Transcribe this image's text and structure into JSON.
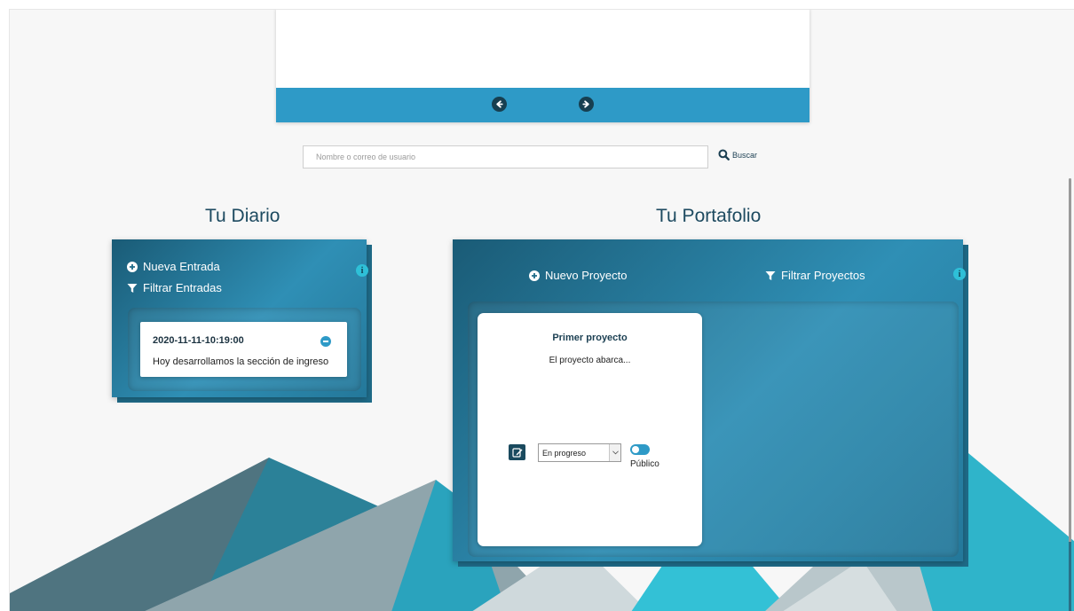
{
  "colors": {
    "accent": "#2e9ac7",
    "panel": "#1f6b88",
    "heading": "#1d4a60",
    "background": "#f7f7f7"
  },
  "carousel": {
    "prev_icon": "arrow-circle-left-icon",
    "next_icon": "arrow-circle-right-icon"
  },
  "search": {
    "placeholder": "Nombre o correo de usuario",
    "button_label": "Buscar",
    "icon": "search-icon"
  },
  "diario": {
    "title": "Tu Diario",
    "new_entry_label": "Nueva Entrada",
    "filter_label": "Filtrar Entradas",
    "entries": [
      {
        "date": "2020-11-11-10:19:00",
        "text": "Hoy desarrollamos la sección de ingreso"
      }
    ]
  },
  "portafolio": {
    "title": "Tu Portafolio",
    "new_project_label": "Nuevo Proyecto",
    "filter_label": "Filtrar Proyectos",
    "projects": [
      {
        "title": "Primer proyecto",
        "description": "El proyecto abarca...",
        "status": "En progreso",
        "visibility_label": "Público",
        "is_public": true
      }
    ]
  }
}
